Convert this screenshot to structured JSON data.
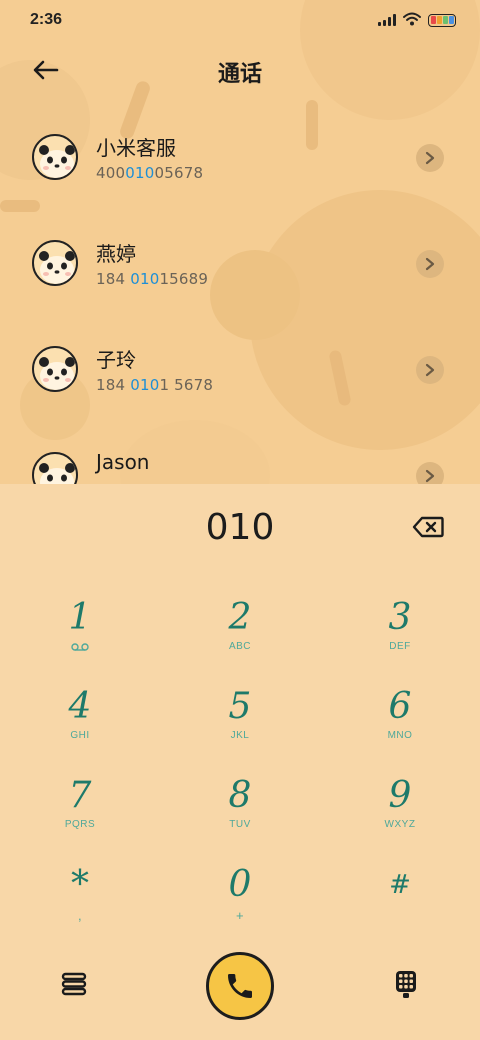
{
  "status_bar": {
    "time": "2:36",
    "icons": [
      "signal-icon",
      "wifi-icon",
      "battery-icon"
    ]
  },
  "header": {
    "title": "通话",
    "back_icon": "back-arrow-icon"
  },
  "contacts": [
    {
      "name": "小米客服",
      "number_parts": [
        "400",
        "010",
        "05678"
      ]
    },
    {
      "name": "燕婷",
      "number_parts": [
        "184 ",
        "010",
        "15689"
      ]
    },
    {
      "name": "子玲",
      "number_parts": [
        "184 ",
        "010",
        "1 5678"
      ]
    },
    {
      "name": "Jason",
      "number_parts": [
        "",
        "",
        ""
      ]
    }
  ],
  "dialer": {
    "entered_number": "010",
    "backspace_icon": "backspace-icon"
  },
  "keypad": [
    {
      "digit": "1",
      "letters": "",
      "icon": "voicemail-icon"
    },
    {
      "digit": "2",
      "letters": "ABC"
    },
    {
      "digit": "3",
      "letters": "DEF"
    },
    {
      "digit": "4",
      "letters": "GHI"
    },
    {
      "digit": "5",
      "letters": "JKL"
    },
    {
      "digit": "6",
      "letters": "MNO"
    },
    {
      "digit": "7",
      "letters": "PQRS"
    },
    {
      "digit": "8",
      "letters": "TUV"
    },
    {
      "digit": "9",
      "letters": "WXYZ"
    },
    {
      "digit": "*",
      "letters": ","
    },
    {
      "digit": "0",
      "letters": "+"
    },
    {
      "digit": "#",
      "letters": ""
    }
  ],
  "bottom_bar": {
    "left_icon": "menu-icon",
    "call_icon": "phone-icon",
    "right_icon": "dialpad-icon"
  },
  "colors": {
    "background": "#f8d7a8",
    "highlight": "#1e8fd6",
    "digit": "#1e7a6a",
    "call_button": "#f6c545"
  }
}
